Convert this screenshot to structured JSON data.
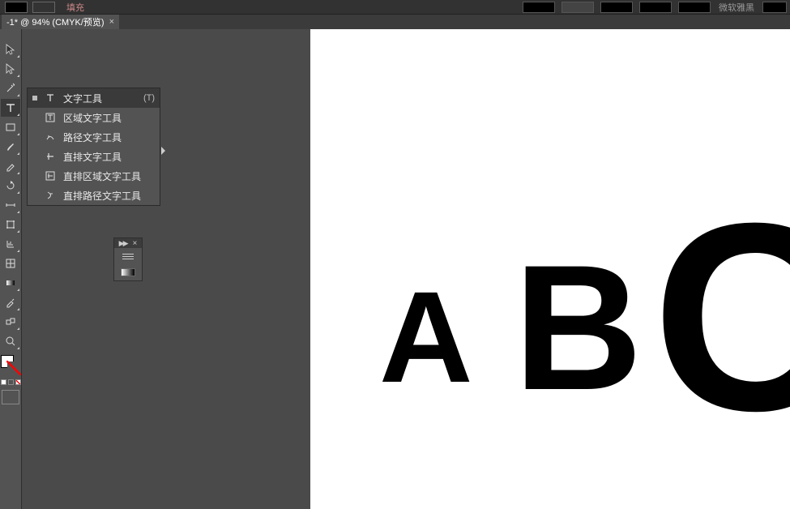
{
  "topbar": {
    "label_fill": "填充",
    "dropdown_hint": "微软雅黑"
  },
  "tab": {
    "title": "-1* @ 94% (CMYK/预览)",
    "close": "×"
  },
  "ctrl": {
    "arrows": "◄◄",
    "x": "×"
  },
  "flyout": {
    "items": [
      {
        "label": "文字工具",
        "shortcut": "(T)",
        "selected": true
      },
      {
        "label": "区域文字工具",
        "shortcut": "",
        "selected": false
      },
      {
        "label": "路径文字工具",
        "shortcut": "",
        "selected": false
      },
      {
        "label": "直排文字工具",
        "shortcut": "",
        "selected": false
      },
      {
        "label": "直排区域文字工具",
        "shortcut": "",
        "selected": false
      },
      {
        "label": "直排路径文字工具",
        "shortcut": "",
        "selected": false
      }
    ]
  },
  "floatpanel": {
    "arrow": "▶▶",
    "close": "×"
  },
  "artboard": {
    "a": "A",
    "b": "B",
    "c": "C"
  }
}
